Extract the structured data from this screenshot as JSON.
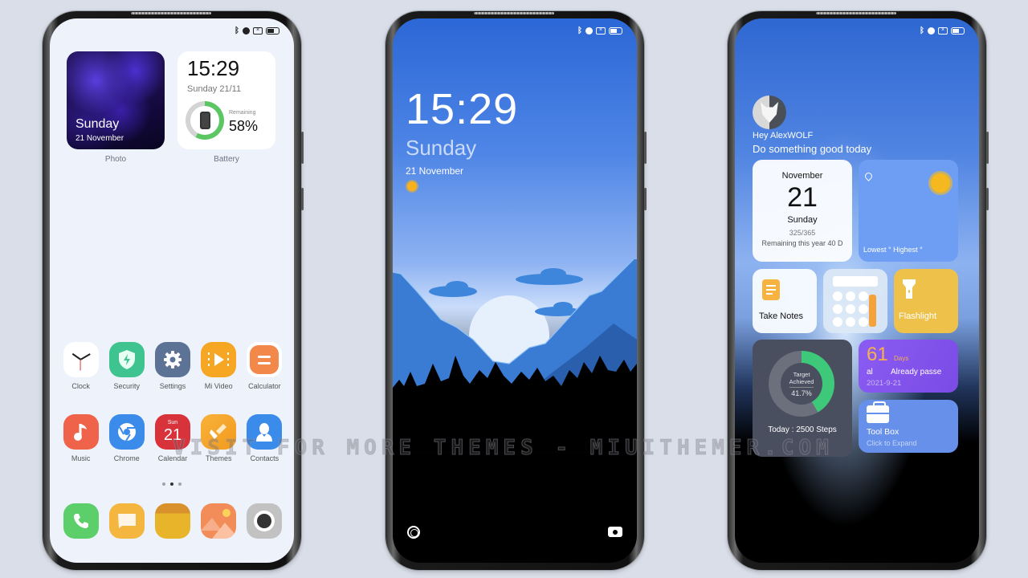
{
  "status_bar": {
    "bluetooth_icon": "bluetooth-icon",
    "alarm_icon": "alarm-icon",
    "sim_icon": "no-sim-icon",
    "battery_icon": "battery-icon"
  },
  "home_screen": {
    "photo_widget": {
      "day": "Sunday",
      "date": "21 November",
      "label": "Photo"
    },
    "battery_widget": {
      "time": "15:29",
      "date": "Sunday 21/11",
      "remaining_label": "Remaining",
      "percent_text": "58%",
      "percent_value": 58,
      "label": "Battery"
    },
    "apps_row1": [
      {
        "label": "Clock",
        "icon": "clock-icon",
        "color": "#ffffff"
      },
      {
        "label": "Security",
        "icon": "shield-icon",
        "color": "#3fc48f"
      },
      {
        "label": "Settings",
        "icon": "gear-icon",
        "color": "#5c7396"
      },
      {
        "label": "Mi Video",
        "icon": "play-icon",
        "color": "#f6a623"
      },
      {
        "label": "Calculator",
        "icon": "calculator-icon",
        "color": "#f2884a"
      }
    ],
    "apps_row2": [
      {
        "label": "Music",
        "icon": "music-note-icon",
        "color": "#f0634b"
      },
      {
        "label": "Chrome",
        "icon": "chrome-icon",
        "color": "#3b8bea"
      },
      {
        "label": "Calendar",
        "icon": "calendar-icon",
        "color": "#d8323b",
        "day_abbr": "Sun",
        "day_num": "21"
      },
      {
        "label": "Themes",
        "icon": "brush-icon",
        "color": "#f4a72a"
      },
      {
        "label": "Contacts",
        "icon": "person-icon",
        "color": "#3b8bea"
      }
    ],
    "page_indicator": {
      "count": 3,
      "active": 1
    },
    "dock": [
      {
        "name": "phone",
        "icon": "phone-icon",
        "color": "#5ccf6a"
      },
      {
        "name": "messages",
        "icon": "message-icon",
        "color": "#f4b63f"
      },
      {
        "name": "notes",
        "icon": "notes-icon",
        "color": "#e8b42a"
      },
      {
        "name": "gallery",
        "icon": "gallery-icon",
        "color": "#f28d5a"
      },
      {
        "name": "camera",
        "icon": "camera-icon",
        "color": "#c2c2c2"
      }
    ]
  },
  "lock_screen": {
    "time": "15:29",
    "day": "Sunday",
    "date": "21 November",
    "weather_icon": "sun-icon",
    "left_shortcut_icon": "circle-icon",
    "right_shortcut_icon": "camera-icon"
  },
  "widget_screen": {
    "greeting": "Hey AlexWOLF",
    "motto": "Do something good today",
    "calendar_card": {
      "month": "November",
      "day": "21",
      "weekday": "Sunday",
      "year_progress": "325/365",
      "remaining": "Remaining this year 40 D"
    },
    "weather_card": {
      "location_icon": "location-pin-icon",
      "weather_icon": "sun-icon",
      "low_high": "Lowest °  Highest °"
    },
    "notes_card": {
      "label": "Take Notes"
    },
    "calculator_card": {
      "icon": "calculator-icon"
    },
    "flashlight_card": {
      "label": "Flashlight"
    },
    "steps_card": {
      "target_label_1": "Target",
      "target_label_2": "Achieved",
      "percent_text": "41.7%",
      "percent_value": 41.7,
      "steps": "Today : 2500 Steps"
    },
    "days_card": {
      "number": "61",
      "unit": "Days",
      "left_text": "al",
      "right_text": "Already passe",
      "date": "2021-9-21"
    },
    "toolbox_card": {
      "title": "Tool Box",
      "subtitle": "Click to Expand"
    }
  },
  "watermark": "VISIT FOR MORE THEMES - MIUITHEMER.COM",
  "colors": {
    "background": "#d9dee8",
    "home_bg": "#edf2fb",
    "battery_ring": "#5cc663",
    "steps_ring": "#3ec97a",
    "accent_purple": "#8b5cf2",
    "accent_blue": "#6690ea"
  }
}
